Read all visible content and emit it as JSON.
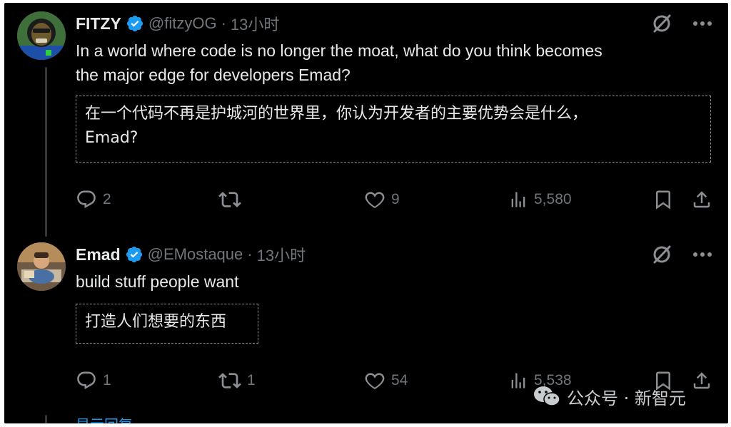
{
  "tweets": [
    {
      "name": "FITZY",
      "handle": "@fitzyOG",
      "separator": "·",
      "time": "13小时",
      "text_line1": "In a world where code is no longer the moat, what do you think becomes",
      "text_line2": "the major edge for developers Emad?",
      "translation_line1": "在一个代码不再是护城河的世界里，你认为开发者的主要优势会是什么，",
      "translation_line2": "Emad?",
      "replies": "2",
      "retweets": "",
      "likes": "9",
      "views": "5,580"
    },
    {
      "name": "Emad",
      "handle": "@EMostaque",
      "separator": "·",
      "time": "13小时",
      "text_line1": "build stuff people want",
      "translation_line1": "打造人们想要的东西",
      "replies": "1",
      "retweets": "1",
      "likes": "54",
      "views": "5,538"
    }
  ],
  "show_replies": "显示回复",
  "watermark": "公众号 · 新智元",
  "icons": {
    "verified": "verified-badge-icon",
    "grok": "grok-icon",
    "more": "more-icon",
    "reply": "reply-icon",
    "retweet": "retweet-icon",
    "like": "like-icon",
    "views": "views-icon",
    "bookmark": "bookmark-icon",
    "share": "share-icon",
    "wechat": "wechat-icon"
  },
  "colors": {
    "background": "#000000",
    "text": "#e7e9ea",
    "secondary": "#71767b",
    "accent": "#1d9bf0",
    "verified": "#1d9bf0"
  }
}
